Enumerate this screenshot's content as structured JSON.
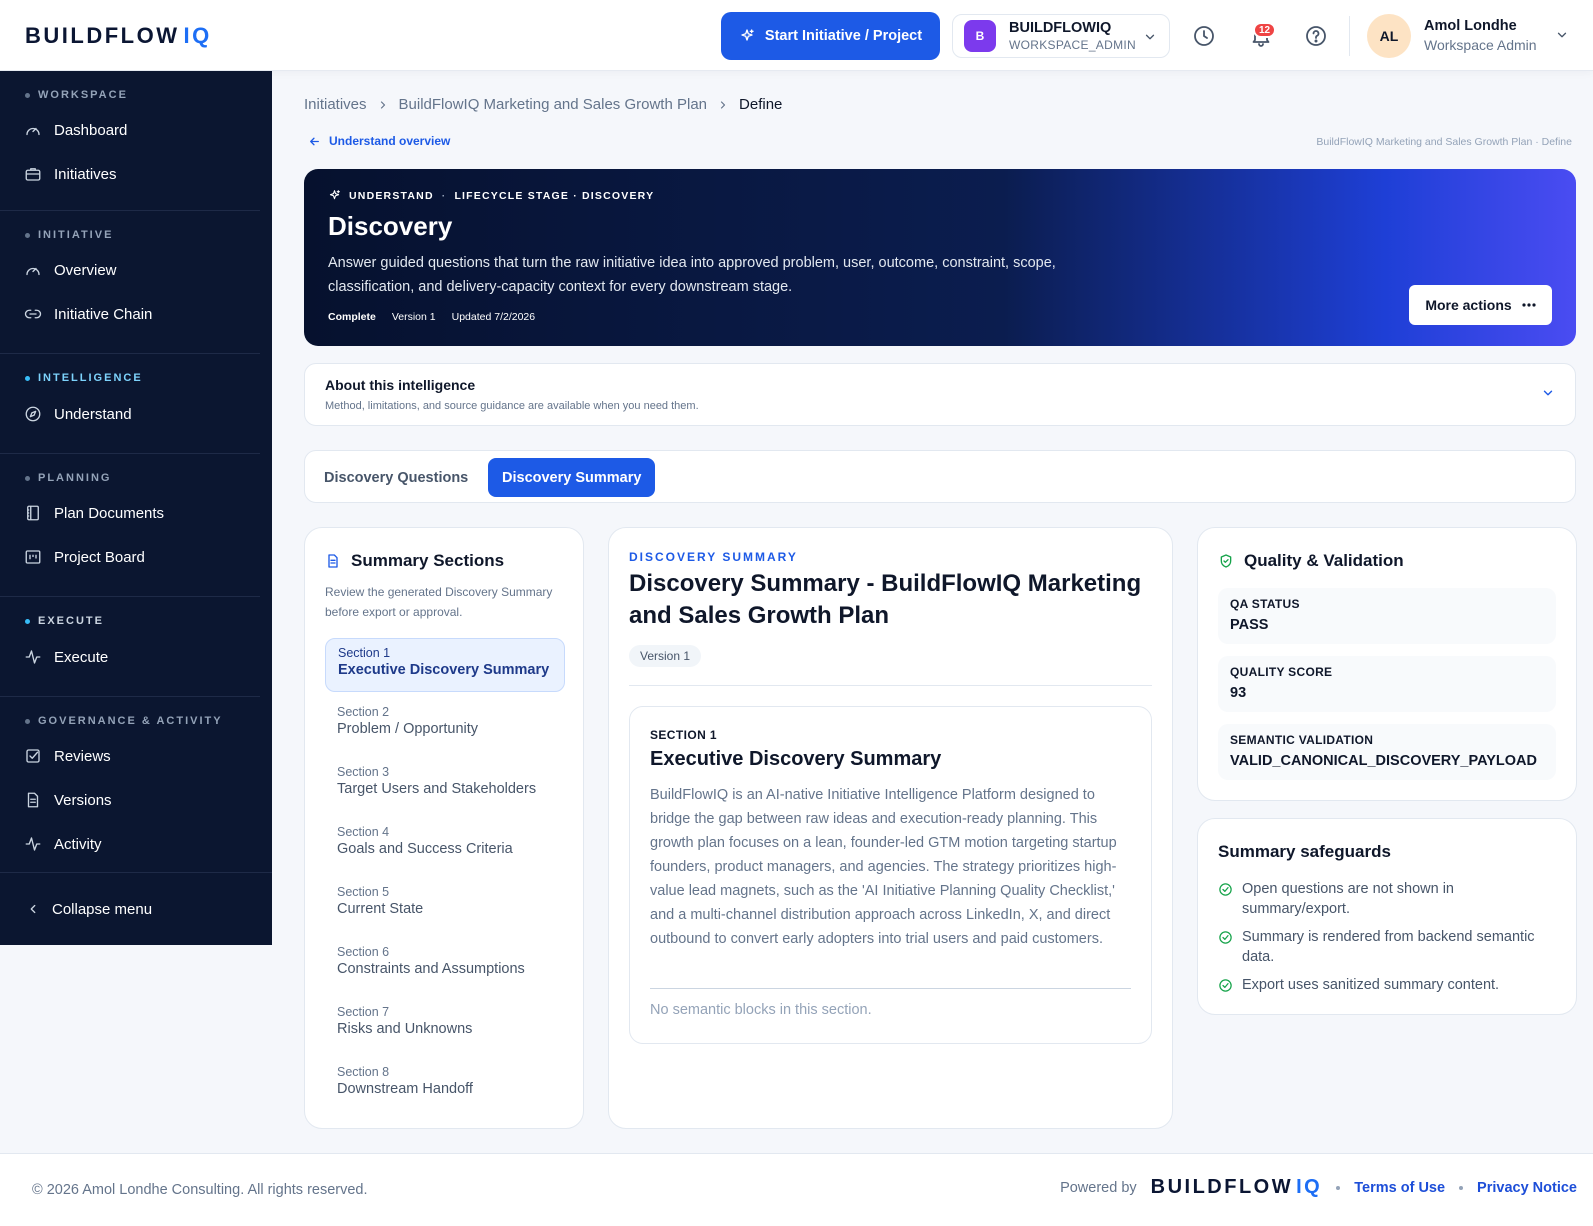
{
  "header": {
    "logo_main": "BUILDFLOW",
    "logo_accent": "IQ",
    "start_button": "Start Initiative / Project",
    "workspace": {
      "initial": "B",
      "name": "BUILDFLOWIQ",
      "role": "WORKSPACE_ADMIN"
    },
    "notifications_count": "12",
    "user": {
      "initials": "AL",
      "name": "Amol Londhe",
      "role": "Workspace Admin"
    }
  },
  "sidebar": {
    "groups": [
      {
        "label": "WORKSPACE",
        "items": [
          "Dashboard",
          "Initiatives"
        ]
      },
      {
        "label": "INITIATIVE",
        "items": [
          "Overview",
          "Initiative Chain"
        ]
      },
      {
        "label": "INTELLIGENCE",
        "items": [
          "Understand"
        ]
      },
      {
        "label": "PLANNING",
        "items": [
          "Plan Documents",
          "Project Board"
        ]
      },
      {
        "label": "EXECUTE",
        "items": [
          "Execute"
        ]
      },
      {
        "label": "GOVERNANCE & ACTIVITY",
        "items": [
          "Reviews",
          "Versions",
          "Activity"
        ]
      }
    ],
    "collapse_label": "Collapse menu"
  },
  "breadcrumb": [
    "Initiatives",
    "BuildFlowIQ Marketing and Sales Growth Plan",
    "Define"
  ],
  "back_link": "Understand overview",
  "right_crumb": "BuildFlowIQ Marketing and Sales Growth Plan · Define",
  "hero": {
    "tag_primary": "UNDERSTAND",
    "tag_sep": "·",
    "tag_secondary": "LIFECYCLE STAGE · DISCOVERY",
    "title": "Discovery",
    "description": "Answer guided questions that turn the raw initiative idea into approved problem, user, outcome, constraint, scope, classification, and delivery-capacity context for every downstream stage.",
    "status": "Complete",
    "version": "Version 1",
    "updated": "Updated 7/2/2026",
    "more_actions": "More actions"
  },
  "about": {
    "title": "About this intelligence",
    "subtitle": "Method, limitations, and source guidance are available when you need them."
  },
  "tabs": [
    "Discovery Questions",
    "Discovery Summary"
  ],
  "sections_panel": {
    "title": "Summary Sections",
    "subtitle": "Review the generated Discovery Summary before export or approval.",
    "items": [
      {
        "num": "Section 1",
        "title": "Executive Discovery Summary"
      },
      {
        "num": "Section 2",
        "title": "Problem / Opportunity"
      },
      {
        "num": "Section 3",
        "title": "Target Users and Stakeholders"
      },
      {
        "num": "Section 4",
        "title": "Goals and Success Criteria"
      },
      {
        "num": "Section 5",
        "title": "Current State"
      },
      {
        "num": "Section 6",
        "title": "Constraints and Assumptions"
      },
      {
        "num": "Section 7",
        "title": "Risks and Unknowns"
      },
      {
        "num": "Section 8",
        "title": "Downstream Handoff"
      }
    ]
  },
  "summary": {
    "kicker": "DISCOVERY SUMMARY",
    "title": "Discovery Summary - BuildFlowIQ Marketing and Sales Growth Plan",
    "version": "Version 1",
    "section_kicker": "SECTION 1",
    "section_title": "Executive Discovery Summary",
    "section_body": "BuildFlowIQ is an AI-native Initiative Intelligence Platform designed to bridge the gap between raw ideas and execution-ready planning. This growth plan focuses on a lean, founder-led GTM motion targeting startup founders, product managers, and agencies. The strategy prioritizes high-value lead magnets, such as the 'AI Initiative Planning Quality Checklist,' and a multi-channel distribution approach across LinkedIn, X, and direct outbound to convert early adopters into trial users and paid customers.",
    "section_empty": "No semantic blocks in this section."
  },
  "quality": {
    "title": "Quality & Validation",
    "items": [
      {
        "label": "QA STATUS",
        "value": "PASS"
      },
      {
        "label": "QUALITY SCORE",
        "value": "93"
      },
      {
        "label": "SEMANTIC VALIDATION",
        "value": "VALID_CANONICAL_DISCOVERY_PAYLOAD"
      }
    ]
  },
  "safeguards": {
    "title": "Summary safeguards",
    "items": [
      "Open questions are not shown in summary/export.",
      "Summary is rendered from backend semantic data.",
      "Export uses sanitized summary content."
    ]
  },
  "footer": {
    "copyright": "© 2026 Amol Londhe Consulting. All rights reserved.",
    "powered_by": "Powered by",
    "terms": "Terms of Use",
    "privacy": "Privacy Notice"
  }
}
